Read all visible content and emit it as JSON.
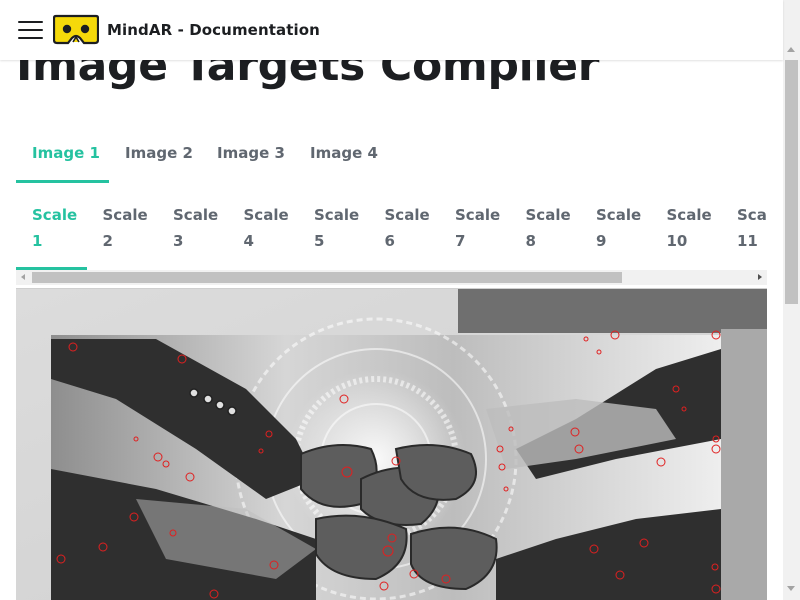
{
  "navbar": {
    "brand_title": "MindAR - Documentation",
    "menu_icon": "hamburger-menu-icon",
    "logo_icon": "cardboard-vr-logo"
  },
  "page": {
    "title": "Image Targets Compiler"
  },
  "image_tabs": [
    {
      "label": "Image 1",
      "active": true
    },
    {
      "label": "Image 2",
      "active": false
    },
    {
      "label": "Image 3",
      "active": false
    },
    {
      "label": "Image 4",
      "active": false
    }
  ],
  "scale_tabs": [
    {
      "w1": "Scale",
      "w2": "1",
      "active": true
    },
    {
      "w1": "Scale",
      "w2": "2",
      "active": false
    },
    {
      "w1": "Scale",
      "w2": "3",
      "active": false
    },
    {
      "w1": "Scale",
      "w2": "4",
      "active": false
    },
    {
      "w1": "Scale",
      "w2": "5",
      "active": false
    },
    {
      "w1": "Scale",
      "w2": "6",
      "active": false
    },
    {
      "w1": "Scale",
      "w2": "7",
      "active": false
    },
    {
      "w1": "Scale",
      "w2": "8",
      "active": false
    },
    {
      "w1": "Scale",
      "w2": "9",
      "active": false
    },
    {
      "w1": "Scale",
      "w2": "10",
      "active": false
    },
    {
      "w1": "Scale",
      "w2": "11",
      "active": false
    }
  ],
  "image_panel": {
    "description_icon": "compiled-image-with-feature-points",
    "feature_marker_color": "#e02020"
  },
  "colors": {
    "accent": "#25c2a0",
    "text": "#1c1e21",
    "tab_inactive": "#606770",
    "logo_yellow": "#f5d90a"
  }
}
